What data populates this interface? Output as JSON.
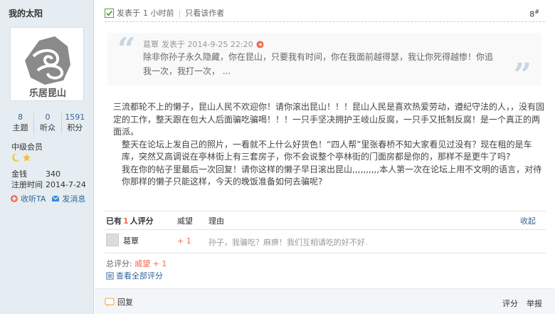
{
  "sidebar": {
    "username": "我的太阳",
    "avatar_caption": "乐居昆山",
    "stats": [
      {
        "num": "8",
        "label": "主题"
      },
      {
        "num": "0",
        "label": "听众"
      },
      {
        "num": "1591",
        "label": "积分"
      }
    ],
    "group": "中级会员",
    "fields": [
      {
        "key": "金钱",
        "value": "340"
      },
      {
        "key": "注册时间",
        "value": "2014-7-24"
      }
    ],
    "actions": [
      "收听TA",
      "发消息"
    ]
  },
  "post": {
    "posted_prefix": "发表于",
    "posted_time": "1 小时前",
    "only_author": "只看该作者",
    "floor": "8",
    "floor_suffix": "#",
    "quote": {
      "author": "葛覃",
      "posted": "发表于 2014-9-25 22:20",
      "text": "除非你孙子永久隐藏，你在昆山，只要我有时间，你在我面前越得瑟，我让你死得越惨！你追我一次，我打一次， ..."
    },
    "paragraphs": [
      "三流都轮不上的懒子，昆山人民不欢迎你！请你滚出昆山！！！昆山人民是喜欢热爱劳动，遵纪守法的人，，没有固定的工作，整天跟在包大人后面骗吃骗喝！！！一只手坚决拥护王岐山反腐，一只手又抵制反腐！是一个真正的两面派。",
      "整天在论坛上发自己的照片，一看就不上什么好货色！“四人帮”里张春桥不知大家看见过没有？现在租的是车库，突然又高调说在亭林街上有三套房子，你不会说整个亭林街的门面房都是你的，那样不是更牛了吗?",
      "我在你的帖子里最后一次回复！请你这样的懒子早日滚出昆山,,,,,,,,,,本人第一次在论坛上用不文明的语言，对待你那样的懒子只能这样，今天的晚饭准备如何去骗呢?"
    ]
  },
  "rating": {
    "header_prefix": "已有",
    "count": "1",
    "header_suffix": "人评分",
    "col_points": "威望",
    "col_reason": "理由",
    "collapse": "收起",
    "rows": [
      {
        "name": "葛覃",
        "points": "+ 1",
        "reason": "孙子，我骗吃？麻痹！我们互相请吃的好不好."
      }
    ],
    "total_label": "总评分:",
    "total_value": "威望 + 1",
    "view_all": "查看全部评分"
  },
  "footer": {
    "reply": "回复",
    "links": [
      "评分",
      "举报"
    ]
  },
  "colors": {
    "accent": "#336699",
    "highlight": "#f26c4f",
    "sidebar_bg": "#e5edf2"
  }
}
